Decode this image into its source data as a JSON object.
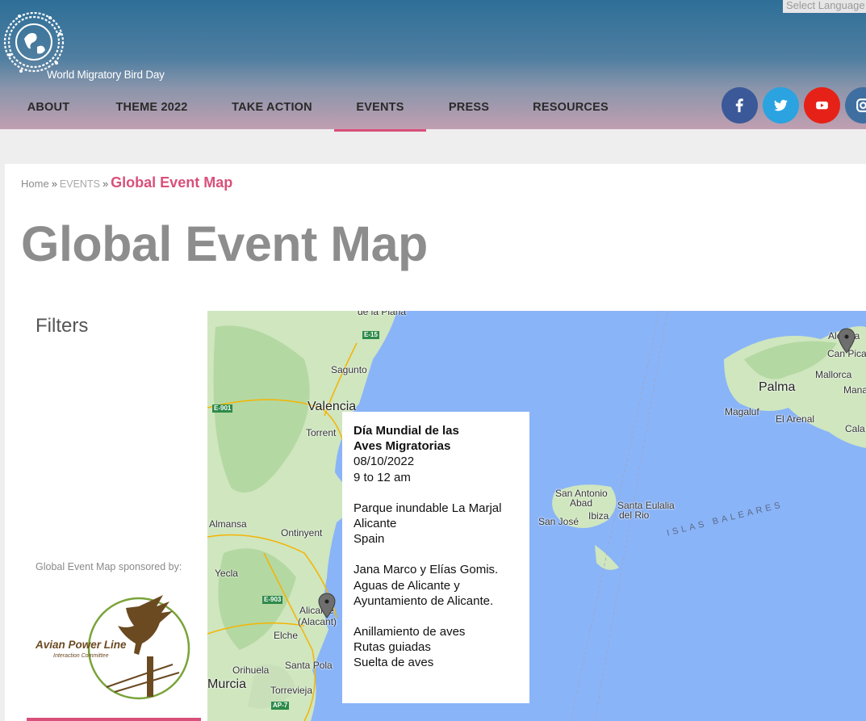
{
  "header": {
    "logo_text": "World Migratory Bird Day",
    "language_select": "Select Language"
  },
  "nav": {
    "items": [
      {
        "label": "ABOUT"
      },
      {
        "label": "THEME 2022"
      },
      {
        "label": "TAKE ACTION"
      },
      {
        "label": "EVENTS",
        "active": true
      },
      {
        "label": "PRESS"
      },
      {
        "label": "RESOURCES"
      }
    ],
    "active_color": "#d9507a"
  },
  "social": [
    {
      "icon": "facebook-icon",
      "color": "#3b5998"
    },
    {
      "icon": "twitter-icon",
      "color": "#2aa3e0"
    },
    {
      "icon": "youtube-icon",
      "color": "#e62117"
    },
    {
      "icon": "instagram-icon",
      "color": "#3f6fa0"
    }
  ],
  "breadcrumb": {
    "home": "Home",
    "sep1": "»",
    "events": "EVENTS",
    "sep2": "»",
    "current": "Global Event Map"
  },
  "page": {
    "title": "Global Event Map",
    "filters_label": "Filters",
    "sponsor_label": "Global Event Map sponsored by:",
    "sponsor_name": "Avian Power Line",
    "sponsor_sub": "Interaction Committee"
  },
  "map": {
    "labels": {
      "la_plana": "de la Plana",
      "sagunto": "Sagunto",
      "valencia": "Valencia",
      "torrent": "Torrent",
      "almansa": "Almansa",
      "ontinyent": "Ontinyent",
      "yecla": "Yecla",
      "alicante": "Alicante",
      "alacant": "(Alacant)",
      "elche": "Elche",
      "santa_pola": "Santa Pola",
      "orihuela": "Orihuela",
      "murcia": "Murcia",
      "torrevieja": "Torrevieja",
      "palma": "Palma",
      "mallorca": "Mallorca",
      "magaluf": "Magaluf",
      "el_arenal": "El Arenal",
      "san_antonio": "San Antonio",
      "abad": "Abad",
      "ibiza": "Ibiza",
      "santa_eulalia": "Santa Eulalia",
      "del_rio": "del Rio",
      "san_jose": "San José",
      "islas_baleares": "ISLAS BALEARES",
      "can_picafort": "Can Pica",
      "alcudia": "Alcudia",
      "manacor": "Mana",
      "cala": "Cala"
    },
    "roads": {
      "e15": "E-15",
      "e901": "E-901",
      "e903": "E-903",
      "ap7": "AP-7"
    },
    "infowindow": {
      "title_line1": "Día Mundial de las",
      "title_line2": "Aves Migratorias",
      "date": "08/10/2022",
      "time": "9 to 12 am",
      "venue": "Parque inundable La Marjal",
      "city": "Alicante",
      "country": "Spain",
      "org_line1": "Jana Marco y Elías Gomis.",
      "org_line2": "Aguas de Alicante y",
      "org_line3": "Ayuntamiento de Alicante.",
      "activity1": "Anillamiento de aves",
      "activity2": "Rutas guiadas",
      "activity3": "Suelta de aves"
    }
  }
}
